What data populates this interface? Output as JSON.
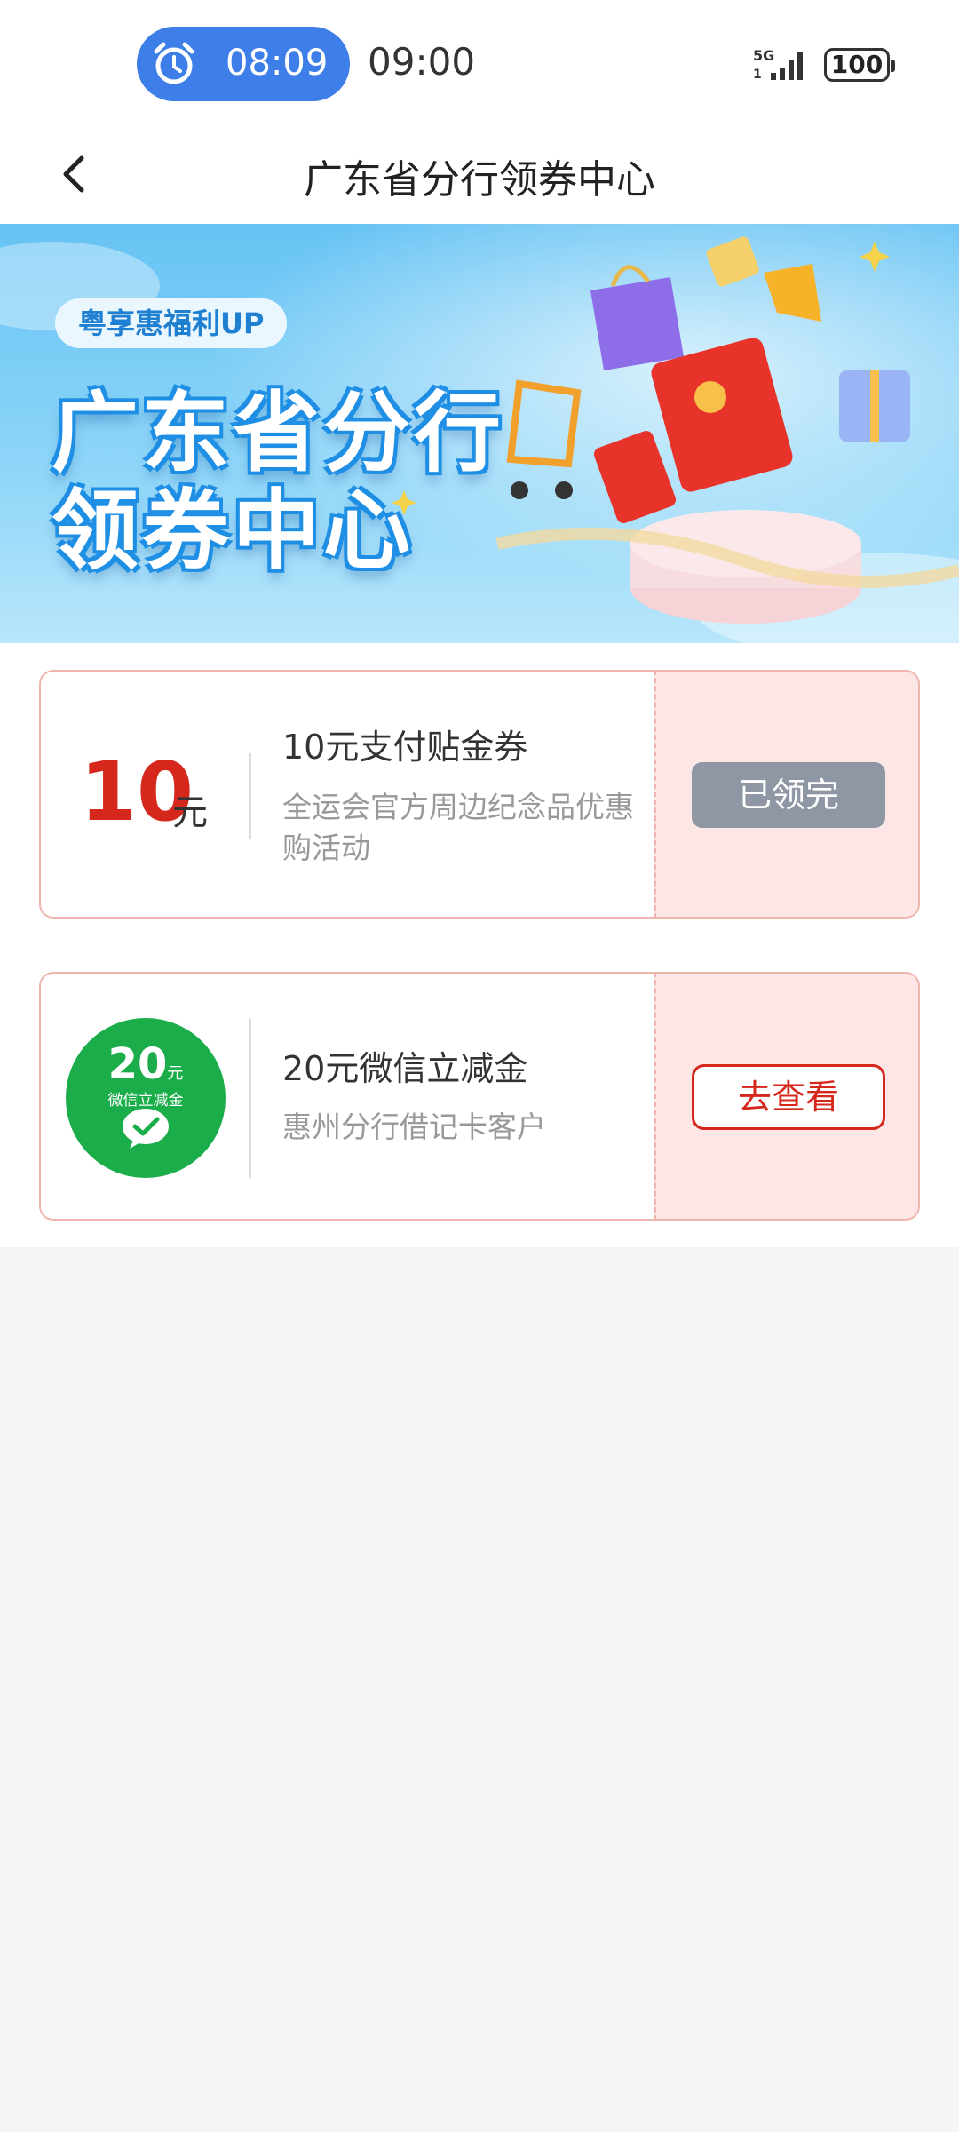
{
  "status_bar": {
    "alarm_time": "08:09",
    "clock": "09:00",
    "network": "5G",
    "battery": "100"
  },
  "nav": {
    "title": "广东省分行领券中心"
  },
  "banner": {
    "tag": "粤享惠福利UP",
    "title_line1": "广东省分行",
    "title_line2": "领券中心"
  },
  "coupons": [
    {
      "amount": "10",
      "unit": "元",
      "title": "10元支付贴金券",
      "desc": "全运会官方周边纪念品优惠购活动",
      "button": "已领完",
      "button_state": "disabled"
    },
    {
      "badge_amount": "20",
      "badge_unit": "元",
      "badge_sub": "微信立减金",
      "title": "20元微信立减金",
      "desc": "惠州分行借记卡客户",
      "button": "去查看",
      "button_state": "active"
    }
  ],
  "colors": {
    "accent_red": "#d6271c",
    "alarm_blue": "#3d7ee8",
    "wechat_green": "#1aad4a",
    "disabled_gray": "#8e97a3"
  }
}
